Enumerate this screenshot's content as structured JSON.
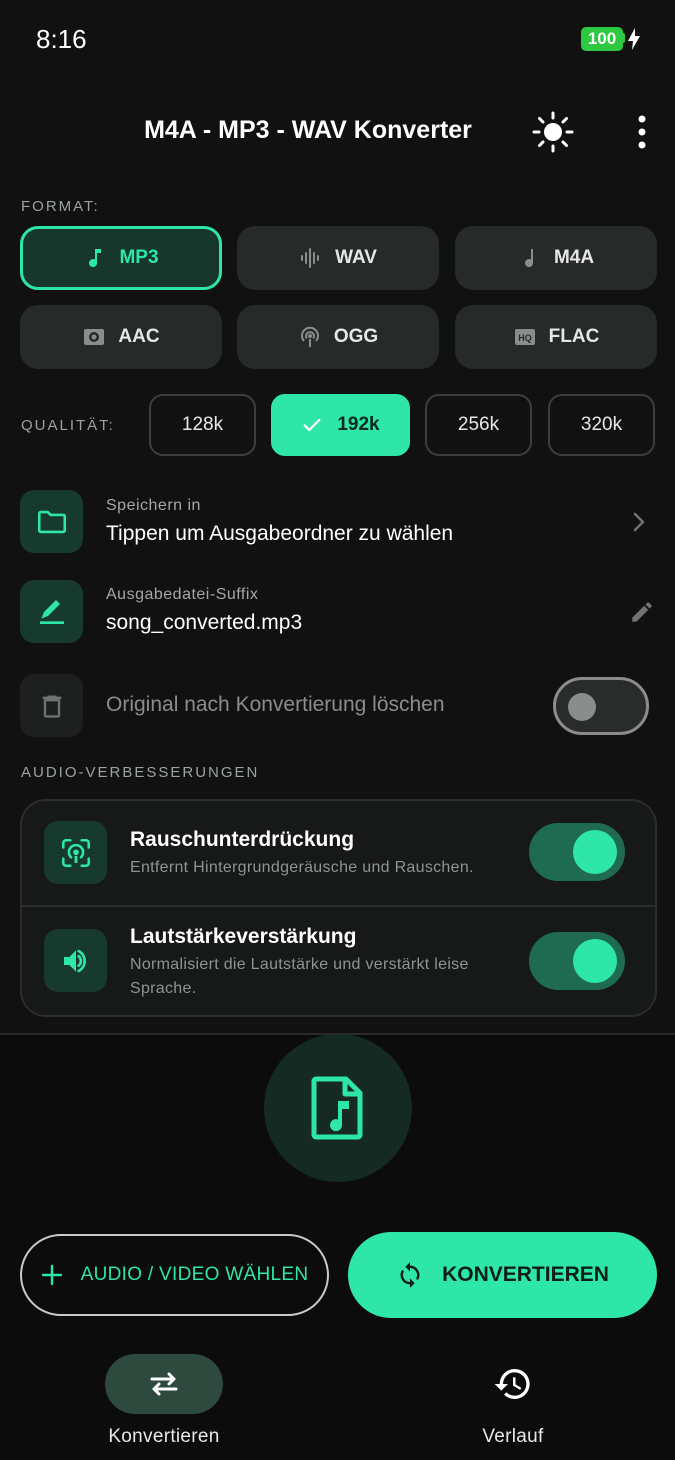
{
  "status_bar": {
    "time": "8:16",
    "battery": "100"
  },
  "app_bar": {
    "title": "M4A - MP3 - WAV Konverter",
    "theme_icon": "sun-icon",
    "menu_icon": "more-vert-icon"
  },
  "format": {
    "label": "FORMAT:",
    "options": [
      {
        "label": "MP3",
        "icon": "music-note-icon",
        "selected": true
      },
      {
        "label": "WAV",
        "icon": "waveform-icon",
        "selected": false
      },
      {
        "label": "M4A",
        "icon": "music-note-icon",
        "selected": false
      },
      {
        "label": "AAC",
        "icon": "audio-file-icon",
        "selected": false
      },
      {
        "label": "OGG",
        "icon": "podcast-icon",
        "selected": false
      },
      {
        "label": "FLAC",
        "icon": "hq-icon",
        "selected": false
      }
    ]
  },
  "quality": {
    "label": "QUALITÄT:",
    "options": [
      {
        "label": "128k",
        "selected": false
      },
      {
        "label": "192k",
        "selected": true
      },
      {
        "label": "256k",
        "selected": false
      },
      {
        "label": "320k",
        "selected": false
      }
    ]
  },
  "save_location": {
    "label": "Speichern in",
    "value": "Tippen um Ausgabeordner zu wählen"
  },
  "suffix": {
    "label": "Ausgabedatei-Suffix",
    "value": "song_converted.mp3"
  },
  "delete_original": {
    "label": "Original nach Konvertierung löschen",
    "enabled": false
  },
  "enhancements": {
    "label": "AUDIO-VERBESSERUNGEN",
    "items": [
      {
        "title": "Rauschunterdrückung",
        "description": "Entfernt Hintergrundgeräusche und Rauschen.",
        "enabled": true
      },
      {
        "title": "Lautstärkeverstärkung",
        "description": "Normalisiert die Lautstärke und verstärkt leise Sprache.",
        "enabled": true
      }
    ]
  },
  "actions": {
    "pick_label": "AUDIO / VIDEO WÄHLEN",
    "convert_label": "KONVERTIEREN"
  },
  "bottom_nav": {
    "convert_label": "Konvertieren",
    "history_label": "Verlauf"
  },
  "colors": {
    "accent": "#2ee6a8",
    "background": "#111111",
    "surface": "#262a28"
  }
}
